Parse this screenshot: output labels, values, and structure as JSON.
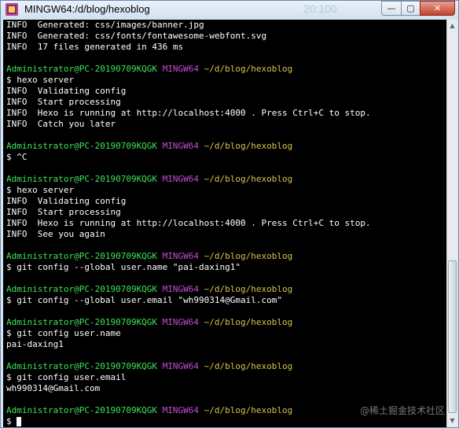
{
  "window": {
    "title": "MINGW64:/d/blog/hexoblog",
    "ghost_text": "20:100",
    "minimize_glyph": "—",
    "maximize_glyph": "▢",
    "close_glyph": "✕"
  },
  "terminal": {
    "prompt_user": "Administrator@PC-20190709KQGK",
    "prompt_shell": "MINGW64",
    "prompt_path": "~/d/blog/hexoblog",
    "lines": {
      "l1": "INFO  Generated: css/images/banner.jpg",
      "l2": "INFO  Generated: css/fonts/fontawesome-webfont.svg",
      "l3": "INFO  17 files generated in 436 ms",
      "l6": "$ hexo server",
      "l7": "INFO  Validating config",
      "l8": "INFO  Start processing",
      "l9": "INFO  Hexo is running at http://localhost:4000 . Press Ctrl+C to stop.",
      "l10": "INFO  Catch you later",
      "l13": "$ ^C",
      "l16": "$ hexo server",
      "l17": "INFO  Validating config",
      "l18": "INFO  Start processing",
      "l19": "INFO  Hexo is running at http://localhost:4000 . Press Ctrl+C to stop.",
      "l20": "INFO  See you again",
      "l23": "$ git config --global user.name \"pai-daxing1\"",
      "l26": "$ git config --global user.email \"wh990314@Gmail.com\"",
      "l29": "$ git config user.name",
      "l30": "pai-daxing1",
      "l33": "$ git config user.email",
      "l34": "wh990314@Gmail.com",
      "l37": "$ "
    }
  },
  "watermark": "@稀土掘金技术社区",
  "colors": {
    "terminal_bg": "#000000",
    "text": "#ffffff",
    "prompt_user": "#3ee35a",
    "prompt_shell": "#c34cd2",
    "prompt_path": "#d6c44a",
    "close_button": "#c4412a"
  }
}
